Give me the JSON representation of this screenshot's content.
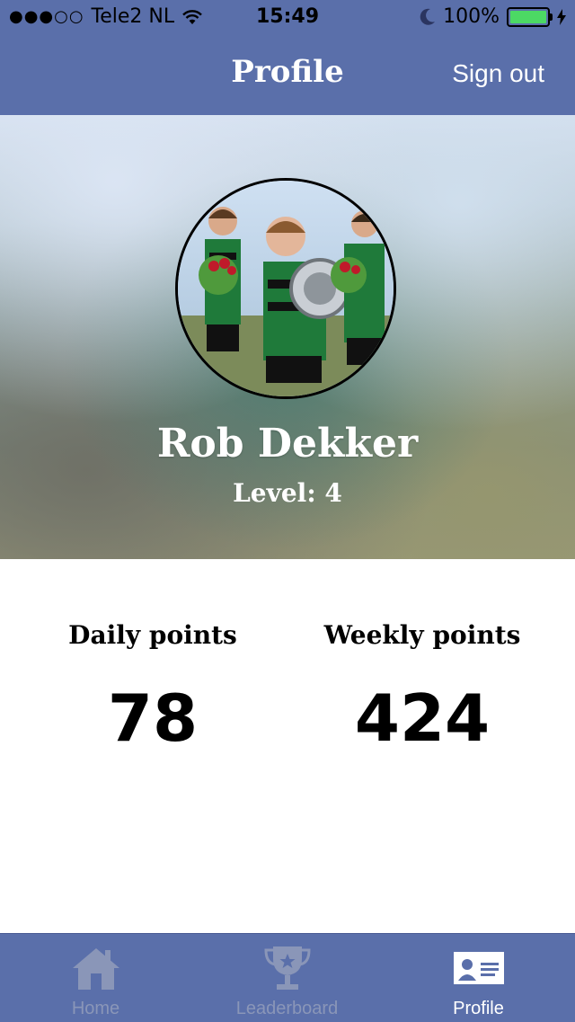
{
  "status_bar": {
    "signal": "●●●○○",
    "carrier": "Tele2 NL",
    "time": "15:49",
    "battery": "100%"
  },
  "header": {
    "title": "Profile",
    "sign_out": "Sign out"
  },
  "profile": {
    "name": "Rob Dekker",
    "level": "Level: 4"
  },
  "stats": {
    "daily_label": "Daily points",
    "daily_value": "78",
    "weekly_label": "Weekly points",
    "weekly_value": "424"
  },
  "tabs": [
    {
      "label": "Home",
      "icon": "home-icon",
      "active": false
    },
    {
      "label": "Leaderboard",
      "icon": "trophy-icon",
      "active": false
    },
    {
      "label": "Profile",
      "icon": "profile-card-icon",
      "active": true
    }
  ],
  "colors": {
    "bar": "#5a6faa",
    "tab_inactive": "#8a96b8",
    "tab_active": "#ffffff",
    "battery_green": "#4cd964"
  }
}
